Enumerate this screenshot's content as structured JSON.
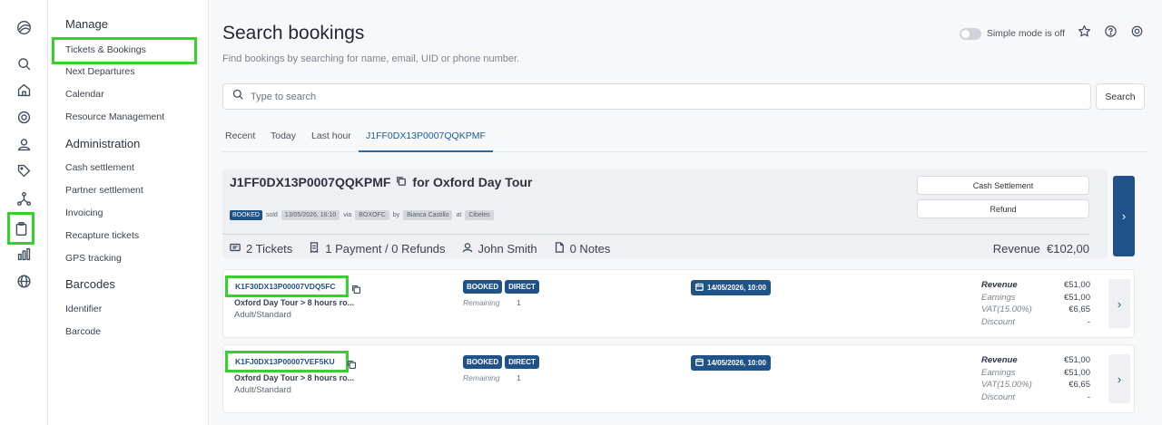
{
  "menu": {
    "sections": [
      {
        "title": "Manage",
        "items": [
          "Tickets & Bookings",
          "Next Departures",
          "Calendar",
          "Resource Management"
        ]
      },
      {
        "title": "Administration",
        "items": [
          "Cash settlement",
          "Partner settlement",
          "Invoicing",
          "Recapture tickets",
          "GPS tracking"
        ]
      },
      {
        "title": "Barcodes",
        "items": [
          "Identifier",
          "Barcode"
        ]
      }
    ]
  },
  "rail_icons": [
    "logo-icon",
    "search-icon",
    "home-icon",
    "gear-icon",
    "user-icon",
    "tag-icon",
    "network-icon",
    "clipboard-icon",
    "chart-icon",
    "globe-icon"
  ],
  "header": {
    "title": "Search bookings",
    "subtitle": "Find bookings by searching for name, email, UID or phone number.",
    "simple_mode": "Simple mode is off"
  },
  "search": {
    "placeholder": "Type to search",
    "value": "",
    "button": "Search"
  },
  "tabs": [
    "Recent",
    "Today",
    "Last hour",
    "J1FF0DX13P0007QQKPMF"
  ],
  "booking": {
    "id": "J1FF0DX13P0007QQKPMF",
    "for_text": "for Oxford Day Tour",
    "status": "BOOKED",
    "sold_label": "sold",
    "sold_at": "13/05/2026, 16:10",
    "via_label": "via",
    "channel": "BOXOFC",
    "by_label": "by",
    "agent": "Bianca Castillo",
    "at_label": "at",
    "location": "Cibeles",
    "cash_settlement": "Cash Settlement",
    "refund": "Refund",
    "tickets": "2 Tickets",
    "payments": "1 Payment / 0 Refunds",
    "customer": "John Smith",
    "notes": "0 Notes",
    "revenue_label": "Revenue",
    "revenue": "€102,00"
  },
  "tickets": [
    {
      "id": "K1F30DX13P00007VDQ5FC",
      "name": "Oxford Day Tour > 8 hours ro...",
      "type": "Adult/Standard",
      "status": "BOOKED",
      "channel": "DIRECT",
      "remaining_label": "Remaining",
      "remaining": "1",
      "date": "14/05/2026, 10:00",
      "revenue_label": "Revenue",
      "revenue": "€51,00",
      "earnings_label": "Earnings",
      "earnings": "€51,00",
      "vat_label": "VAT(15.00%)",
      "vat": "€6,65",
      "discount_label": "Discount",
      "discount": "-"
    },
    {
      "id": "K1FJ0DX13P00007VEF5KU",
      "name": "Oxford Day Tour > 8 hours ro...",
      "type": "Adult/Standard",
      "status": "BOOKED",
      "channel": "DIRECT",
      "remaining_label": "Remaining",
      "remaining": "1",
      "date": "14/05/2026, 10:00",
      "revenue_label": "Revenue",
      "revenue": "€51,00",
      "earnings_label": "Earnings",
      "earnings": "€51,00",
      "vat_label": "VAT(15.00%)",
      "vat": "€6,65",
      "discount_label": "Discount",
      "discount": "-"
    }
  ],
  "colors": {
    "brand": "#1f5288",
    "highlight": "#35d22b"
  }
}
